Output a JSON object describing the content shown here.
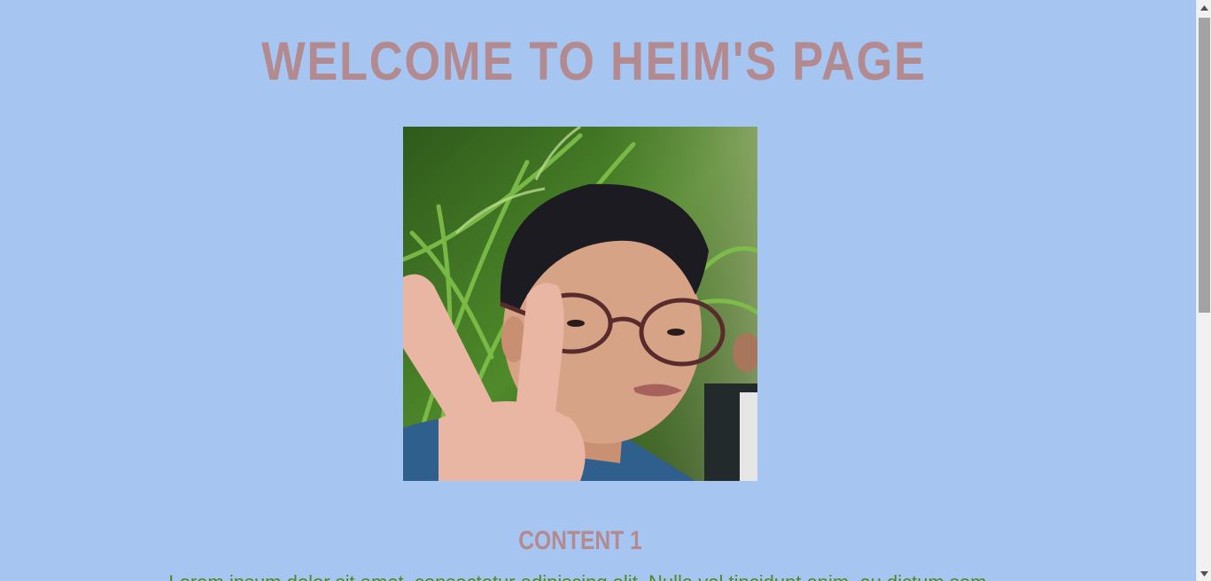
{
  "header": {
    "title": "WELCOME TO HEIM'S PAGE"
  },
  "profile_photo": {
    "icon": "profile-photo"
  },
  "content1": {
    "title": "CONTENT 1",
    "text": "Lorem ipsum dolor sit amet, consectetur adipiscing elit. Nulla vel tincidunt enim, eu dictum sem."
  },
  "colors": {
    "background": "#a6c6f1",
    "heading": "#b38a8f",
    "body_text": "#4d8a22"
  },
  "scrollbar": {
    "up_icon": "scroll-up-arrow-icon",
    "down_icon": "scroll-down-arrow-icon"
  }
}
